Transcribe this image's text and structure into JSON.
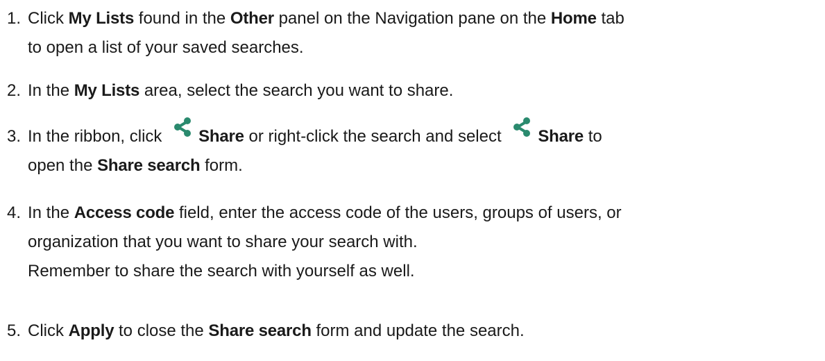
{
  "steps": [
    {
      "num": "1.",
      "parts": {
        "a": "Click ",
        "b": "My Lists",
        "c": " found in the ",
        "d": "Other",
        "e": " panel on the Navigation pane on the ",
        "f": "Home",
        "g": " tab",
        "h": "to open a list of your saved searches."
      }
    },
    {
      "num": "2.",
      "parts": {
        "a": "In the ",
        "b": "My Lists",
        "c": " area, select the search you want to share."
      }
    },
    {
      "num": "3.",
      "parts": {
        "a": "In the ribbon, click ",
        "b": "Share",
        "c": " or right-click the search and select ",
        "d": "Share",
        "e": " to",
        "f": "open the ",
        "g": "Share search",
        "h": " form."
      }
    },
    {
      "num": "4.",
      "parts": {
        "a": "In the ",
        "b": "Access code",
        "c": " field, enter the access code of the users, groups of users, or",
        "d": "organization that you want to share your search with.",
        "e": "Remember to share the search with yourself as well."
      }
    },
    {
      "num": "5.",
      "parts": {
        "a": "Click ",
        "b": "Apply",
        "c": " to close the ",
        "d": "Share search",
        "e": " form and update the search."
      }
    }
  ],
  "icons": {
    "share": "share-icon",
    "color": "#2a8a6e"
  }
}
